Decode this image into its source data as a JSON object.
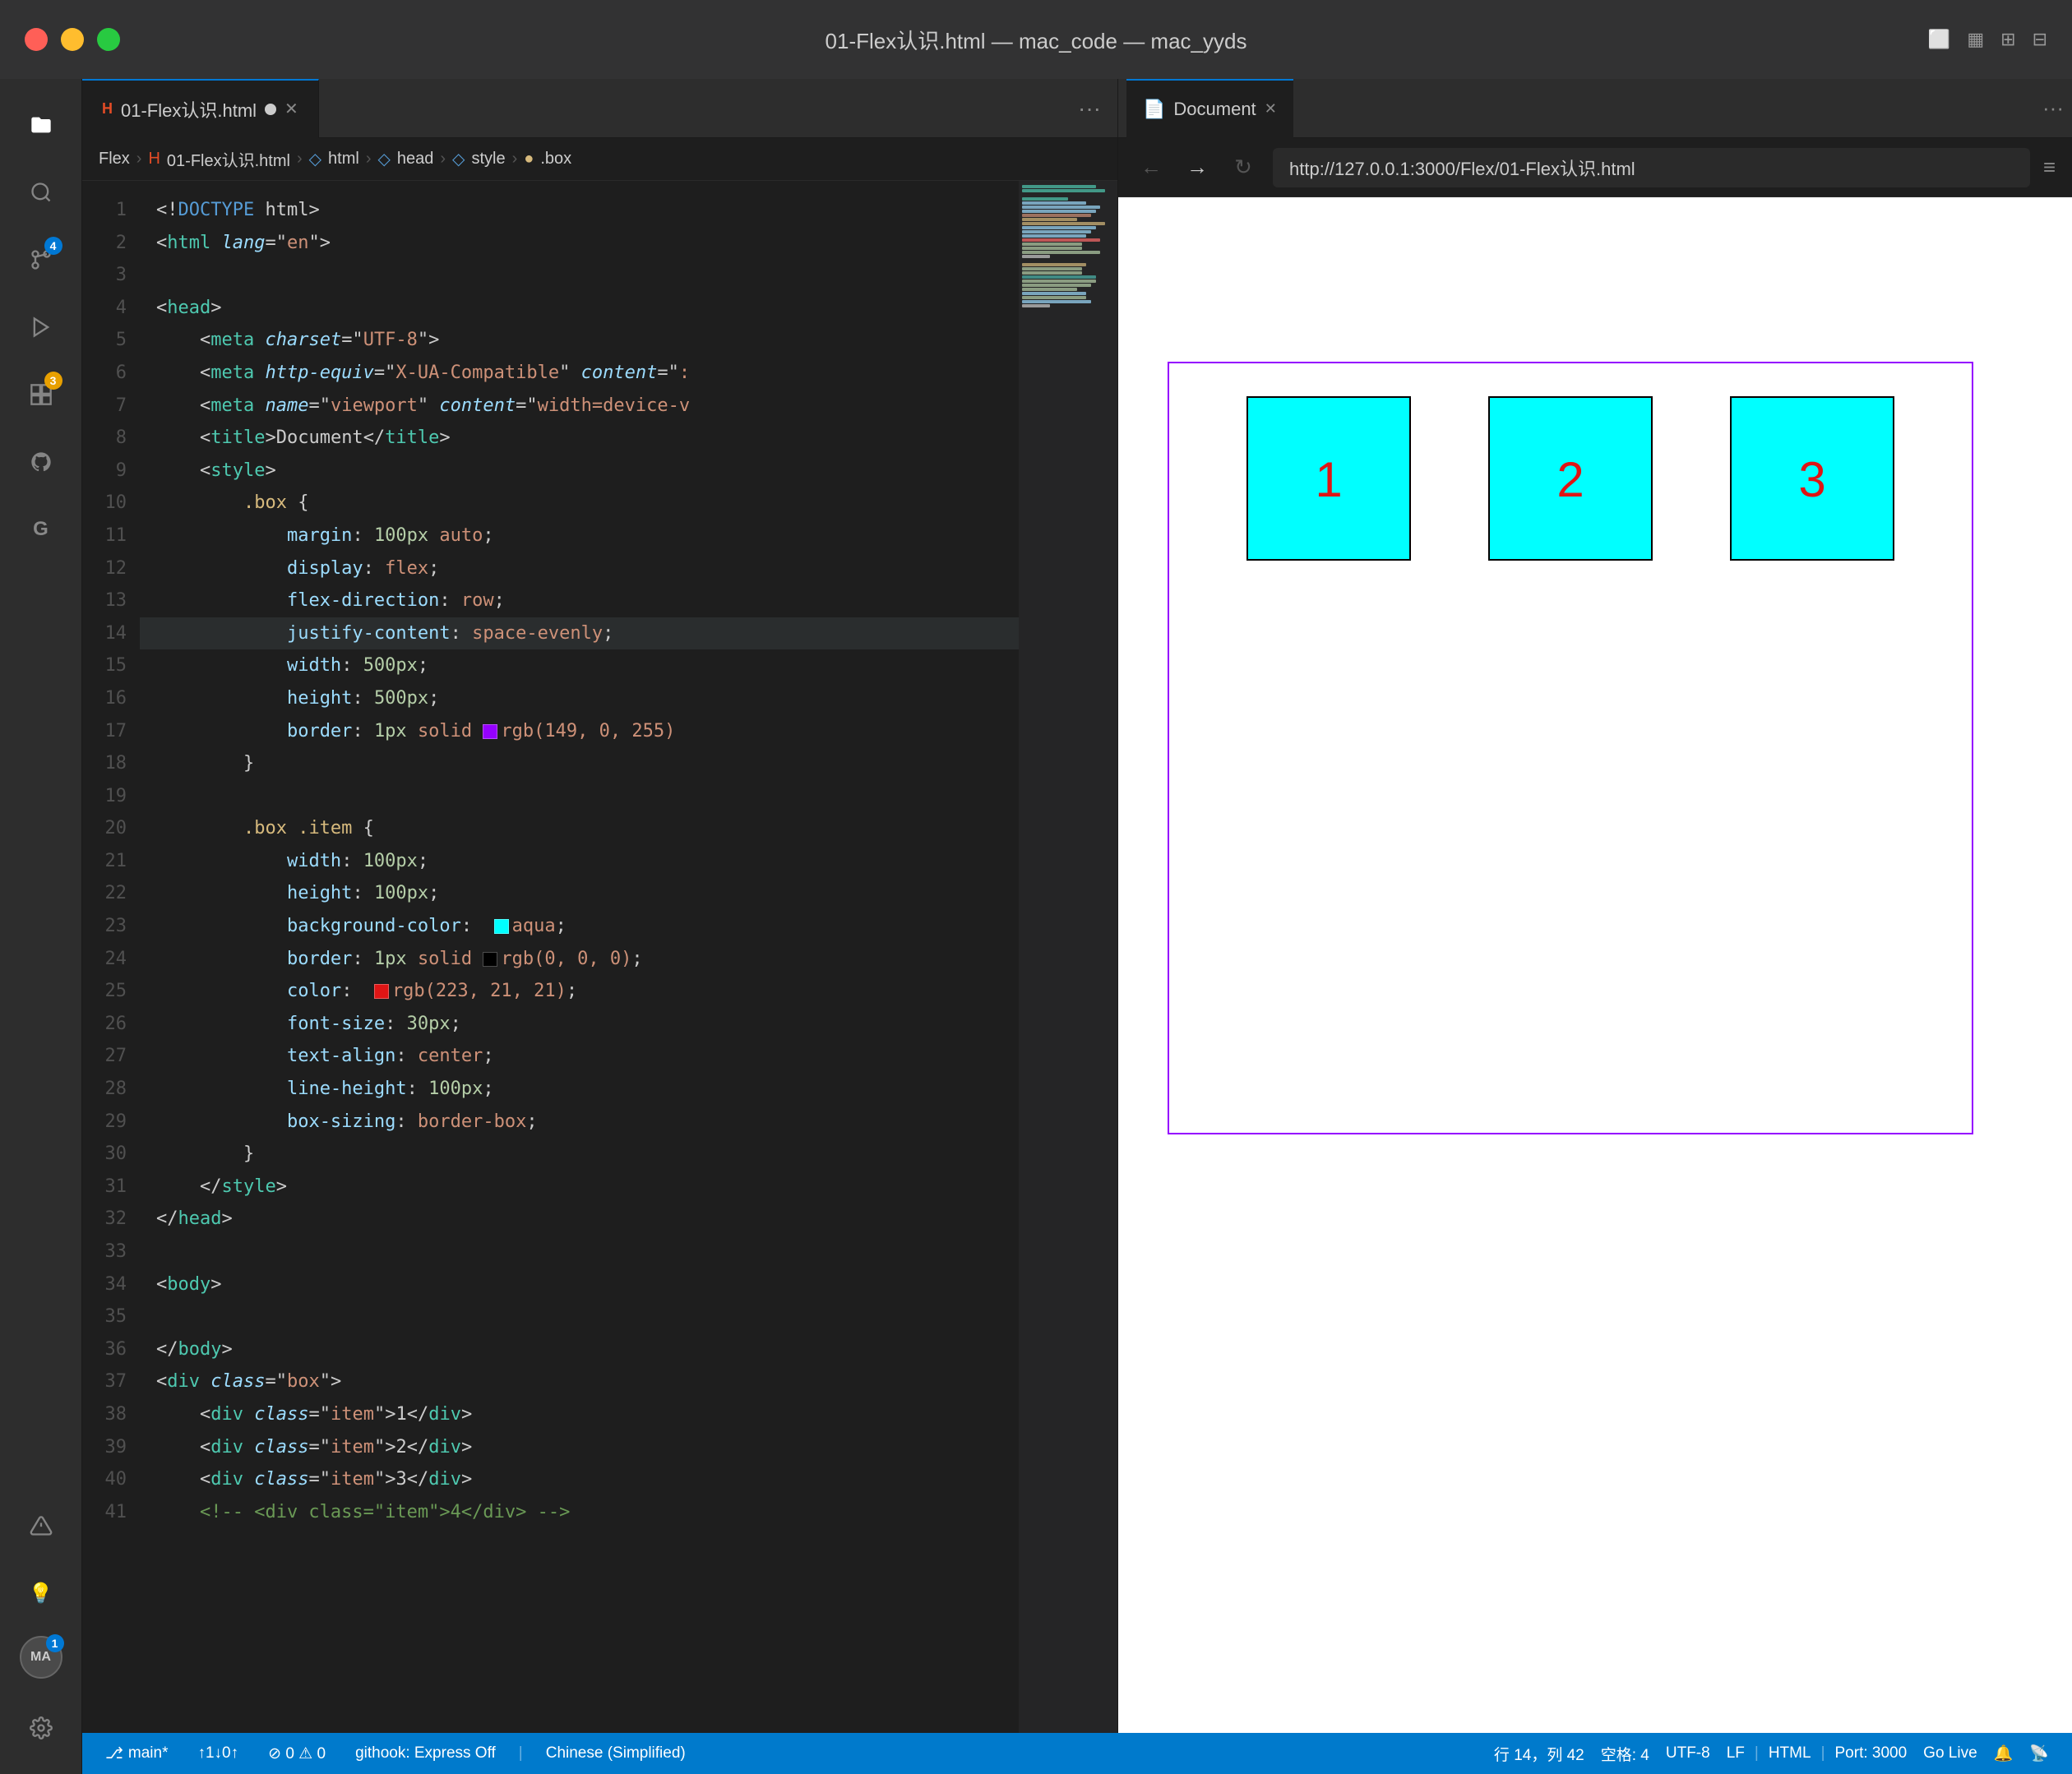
{
  "titlebar": {
    "title": "01-Flex认识.html — mac_code — mac_yyds"
  },
  "tabs": {
    "editor_tab": "01-Flex认识.html",
    "preview_tab": "Document",
    "more_label": "···"
  },
  "breadcrumb": {
    "items": [
      "Flex",
      "01-Flex认识.html",
      "html",
      "head",
      "style",
      ".box"
    ]
  },
  "code": {
    "lines": [
      {
        "n": 1,
        "text": "<!DOCTYPE html>"
      },
      {
        "n": 2,
        "text": "<html lang=\"en\">"
      },
      {
        "n": 3,
        "text": ""
      },
      {
        "n": 4,
        "text": "<head>"
      },
      {
        "n": 5,
        "text": "    <meta charset=\"UTF-8\">"
      },
      {
        "n": 6,
        "text": "    <meta http-equiv=\"X-UA-Compatible\" content=\":"
      },
      {
        "n": 7,
        "text": "    <meta name=\"viewport\" content=\"width=device-v"
      },
      {
        "n": 8,
        "text": "    <title>Document</title>"
      },
      {
        "n": 9,
        "text": "    <style>"
      },
      {
        "n": 10,
        "text": "        .box {"
      },
      {
        "n": 11,
        "text": "            margin: 100px auto;"
      },
      {
        "n": 12,
        "text": "            display: flex;"
      },
      {
        "n": 13,
        "text": "            flex-direction: row;"
      },
      {
        "n": 14,
        "text": "            justify-content: space-evenly;"
      },
      {
        "n": 15,
        "text": "            width: 500px;"
      },
      {
        "n": 16,
        "text": "            height: 500px;"
      },
      {
        "n": 17,
        "text": "            border: 1px solid rgb(149, 0, 255)"
      },
      {
        "n": 18,
        "text": "        }"
      },
      {
        "n": 19,
        "text": ""
      },
      {
        "n": 20,
        "text": "        .box .item {"
      },
      {
        "n": 21,
        "text": "            width: 100px;"
      },
      {
        "n": 22,
        "text": "            height: 100px;"
      },
      {
        "n": 23,
        "text": "            background-color:  aqua;"
      },
      {
        "n": 24,
        "text": "            border: 1px solid rgb(0, 0, 0);"
      },
      {
        "n": 25,
        "text": "            color:  rgb(223, 21, 21);"
      },
      {
        "n": 26,
        "text": "            font-size: 30px;"
      },
      {
        "n": 27,
        "text": "            text-align: center;"
      },
      {
        "n": 28,
        "text": "            line-height: 100px;"
      },
      {
        "n": 29,
        "text": "            box-sizing: border-box;"
      },
      {
        "n": 30,
        "text": "        }"
      },
      {
        "n": 31,
        "text": "    </style>"
      },
      {
        "n": 32,
        "text": "</head>"
      },
      {
        "n": 33,
        "text": ""
      },
      {
        "n": 34,
        "text": "<body>"
      },
      {
        "n": 35,
        "text": ""
      },
      {
        "n": 36,
        "text": "</body>"
      },
      {
        "n": 37,
        "text": "<div class=\"box\">"
      },
      {
        "n": 38,
        "text": "    <div class=\"item\">1</div>"
      },
      {
        "n": 39,
        "text": "    <div class=\"item\">2</div>"
      },
      {
        "n": 40,
        "text": "    <div class=\"item\">3</div>"
      },
      {
        "n": 41,
        "text": "    <!-- <div class=\"item\">4</div> -->"
      }
    ]
  },
  "preview": {
    "url": "http://127.0.0.1:3000/Flex/01-Flex认识.html",
    "items": [
      "1",
      "2",
      "3"
    ]
  },
  "status_bar": {
    "branch": "main*",
    "sync": "↑1↓0↑",
    "errors": "⊘ 0 ⚠ 0",
    "githook": "githook: Express Off",
    "encoding": "UTF-8",
    "eol": "LF",
    "language": "HTML",
    "line_col": "行 14，列 42",
    "spaces": "空格: 4",
    "port": "Port: 3000",
    "golive": "Go Live",
    "notifications": "Chinese (Simplified)"
  },
  "activity": {
    "icons": [
      {
        "name": "files-icon",
        "glyph": "⎗",
        "badge": null
      },
      {
        "name": "search-icon",
        "glyph": "🔍",
        "badge": null
      },
      {
        "name": "source-control-icon",
        "glyph": "⑃",
        "badge": "4"
      },
      {
        "name": "run-icon",
        "glyph": "▶",
        "badge": null
      },
      {
        "name": "extensions-icon",
        "glyph": "⧉",
        "badge": "3"
      },
      {
        "name": "github-icon",
        "glyph": "●",
        "badge": null
      },
      {
        "name": "git-icon",
        "glyph": "G",
        "badge": null
      },
      {
        "name": "warning-icon",
        "glyph": "△",
        "badge": null
      },
      {
        "name": "bulb-icon",
        "glyph": "💡",
        "badge": null
      },
      {
        "name": "avatar-icon",
        "glyph": "MA",
        "badge": "1"
      }
    ]
  }
}
